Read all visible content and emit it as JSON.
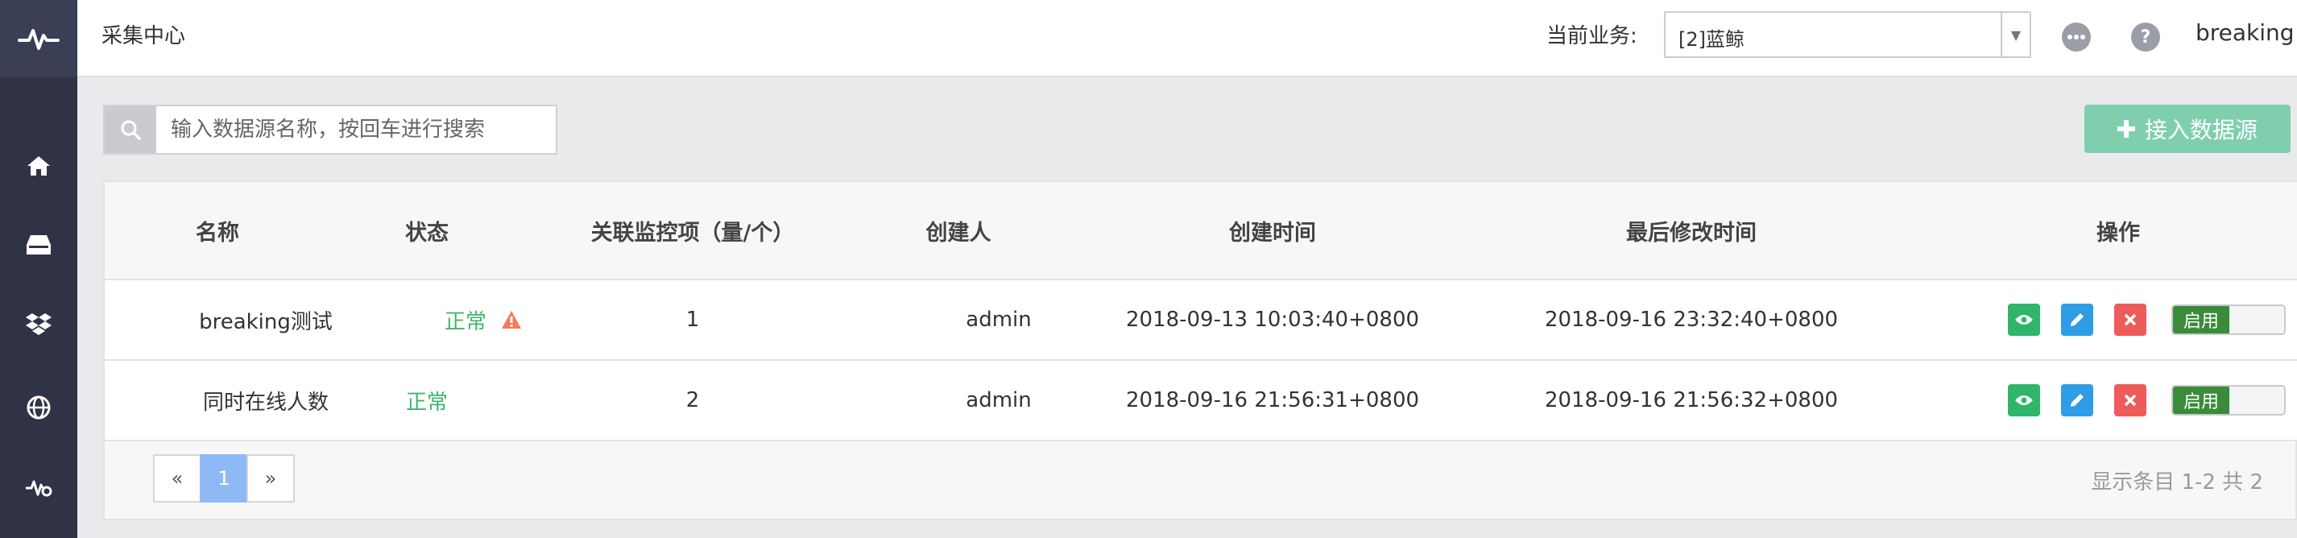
{
  "header": {
    "title": "采集中心",
    "business_label": "当前业务:",
    "business_value": "[2]蓝鲸",
    "username": "breaking"
  },
  "sidebar": {
    "items": [
      {
        "icon": "home-icon"
      },
      {
        "icon": "inbox-icon"
      },
      {
        "icon": "dropbox-icon"
      },
      {
        "icon": "globe-icon"
      },
      {
        "icon": "monitor-settings-icon"
      }
    ]
  },
  "search": {
    "placeholder": "输入数据源名称，按回车进行搜索"
  },
  "add_button": {
    "label": "接入数据源"
  },
  "table": {
    "columns": [
      "名称",
      "状态",
      "关联监控项（量/个）",
      "创建人",
      "创建时间",
      "最后修改时间",
      "操作"
    ],
    "rows": [
      {
        "name": "breaking测试",
        "status": "正常",
        "has_warning": true,
        "count": "1",
        "creator": "admin",
        "created": "2018-09-13 10:03:40+0800",
        "modified": "2018-09-16 23:32:40+0800",
        "toggle": "启用"
      },
      {
        "name": "同时在线人数",
        "status": "正常",
        "has_warning": false,
        "count": "2",
        "creator": "admin",
        "created": "2018-09-16 21:56:31+0800",
        "modified": "2018-09-16 21:56:32+0800",
        "toggle": "启用"
      }
    ]
  },
  "pagination": {
    "prev": "«",
    "current": "1",
    "next": "»",
    "summary": "显示条目 1-2 共 2"
  },
  "colors": {
    "sidebar": "#2f3345",
    "status_ok": "#3fb66b",
    "view": "#2fb66b",
    "edit": "#2e9de6",
    "delete": "#ee5b5b",
    "toggle_on": "#3a8c3a",
    "add_button": "#7fcfae",
    "warning": "#f07c5c"
  }
}
